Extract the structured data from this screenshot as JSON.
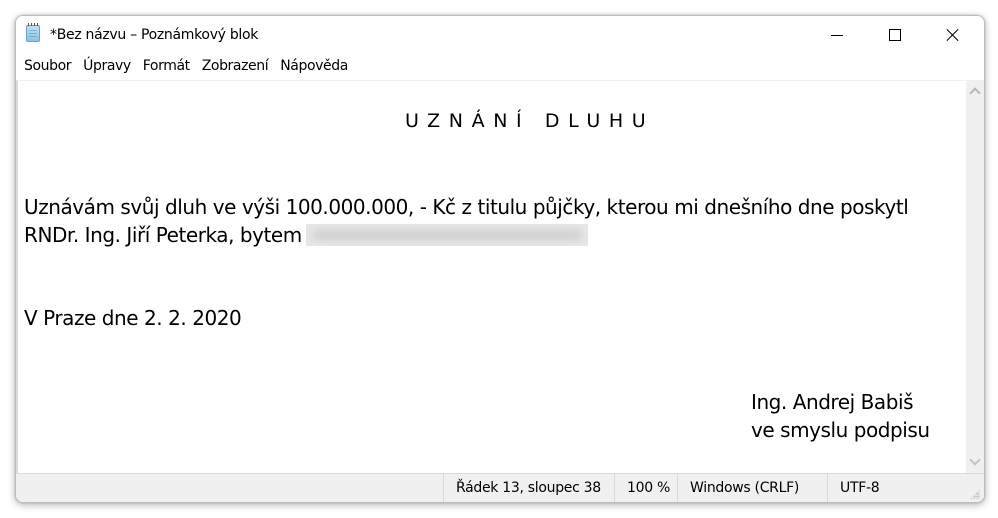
{
  "window": {
    "title": "*Bez názvu – Poznámkový blok",
    "icon": "notepad-icon",
    "controls": {
      "minimize": "minimize-icon",
      "maximize": "maximize-icon",
      "close": "close-icon"
    }
  },
  "menubar": {
    "items": [
      {
        "label": "Soubor"
      },
      {
        "label": "Úpravy"
      },
      {
        "label": "Formát"
      },
      {
        "label": "Zobrazení"
      },
      {
        "label": "Nápověda"
      }
    ]
  },
  "document": {
    "title": "UZNÁNÍ DLUHU",
    "lines": [
      "Uznávám svůj dluh ve výši 100.000.000, - Kč z titulu půjčky, kterou mi dnešního dne poskytl",
      "RNDr. Ing. Jiří Peterka, bytem",
      "V Praze dne 2. 2. 2020"
    ],
    "redacted_address": "[redacted]",
    "signature": [
      "Ing. Andrej Babiš",
      "ve smyslu podpisu"
    ]
  },
  "statusbar": {
    "position": "Řádek 13, sloupec 38",
    "zoom": "100 %",
    "line_ending": "Windows (CRLF)",
    "encoding": "UTF-8"
  }
}
